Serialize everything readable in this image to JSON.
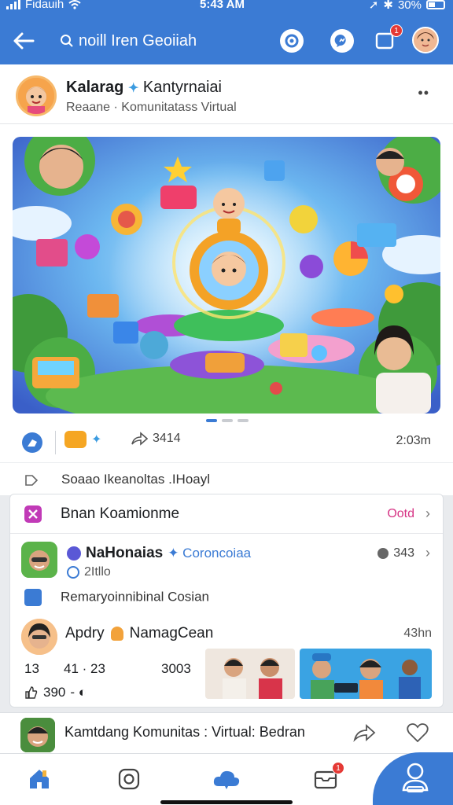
{
  "status_bar": {
    "carrier": "Fidauih",
    "time": "5:43 AM",
    "battery": "30%"
  },
  "header": {
    "search_text": "noill Iren Geoiiah",
    "notification_count": "1"
  },
  "post": {
    "title": "Kalarag",
    "title_suffix": "Kantyrnaiai",
    "subtitle": "Reaane · Komunitatass Virtual",
    "more": "••",
    "share_count": "3414",
    "time": "2:03m",
    "caption": "Soaao Ikeanoltas .IHoayl"
  },
  "community": {
    "header_title": "Bnan Koamionme",
    "header_link": "Ootd",
    "group": {
      "name": "NaHonaias",
      "tag": "Coroncoiaa",
      "sub": "2Itllo",
      "count": "343",
      "description": "Remaryoinnibinal Cosian"
    },
    "post": {
      "user": "Apdry",
      "user_suffix": "NamagCean",
      "time": "43hn",
      "stat_a": "13",
      "stat_b": "41 · 23",
      "stat_c": "3003",
      "likes": "390",
      "likes_suffix": "- ◐"
    }
  },
  "preview": {
    "text": "Kamtdang Komunitas : Virtual: Bedran"
  },
  "nav": {
    "notification_count": "1"
  },
  "colors": {
    "brand": "#3b7bd4",
    "accent": "#d63384",
    "badge": "#e53935"
  }
}
